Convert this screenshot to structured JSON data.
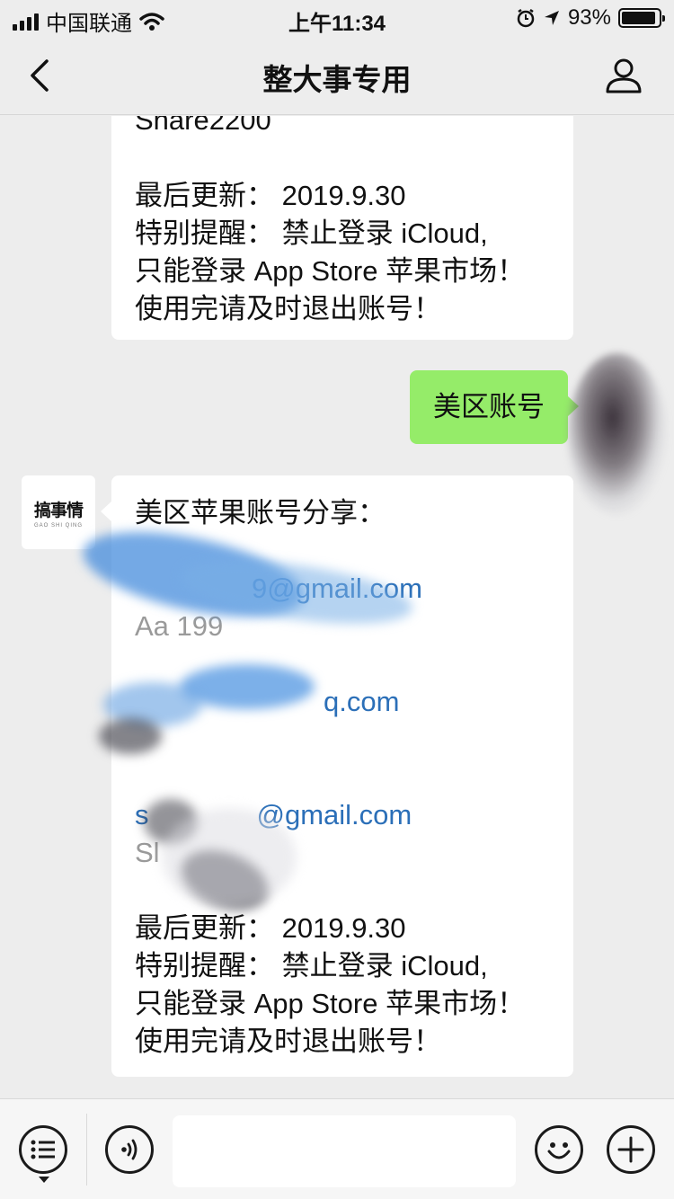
{
  "status_bar": {
    "carrier": "中国联通",
    "time": "上午11:34",
    "battery_percent": "93%",
    "battery_level": 0.93
  },
  "nav": {
    "title": "整大事专用"
  },
  "messages": {
    "first": {
      "partial_top": "Share2200",
      "updated": "最后更新： 2019.9.30",
      "reminder_1": "特别提醒： 禁止登录 iCloud,",
      "reminder_2": "只能登录 App Store 苹果市场！",
      "reminder_3": "使用完请及时退出账号！"
    },
    "sent": {
      "text": "美区账号"
    },
    "second": {
      "heading": "美区苹果账号分享：",
      "email_1_tail": "9@gmail.com",
      "password_1_tail": "Aa      199",
      "email_2_tail": "q.com",
      "email_3_tail": "@gmail.com",
      "email_3_start": "s",
      "password_3_start": "Sl",
      "updated": "最后更新： 2019.9.30",
      "reminder_1": "特别提醒： 禁止登录 iCloud,",
      "reminder_2": "只能登录 App Store 苹果市场！",
      "reminder_3": "使用完请及时退出账号！"
    }
  },
  "avatar_left": {
    "logo_text": "搞事情",
    "logo_sub": "GAO SHI QING"
  },
  "colors": {
    "background": "#ededed",
    "sent_bubble": "#95ec69",
    "received_bubble": "#ffffff",
    "link": "#2b6fb8"
  },
  "icons": {
    "back": "chevron-left-icon",
    "profile": "person-icon",
    "menu": "list-menu-icon",
    "voice": "voice-icon",
    "emoji": "smiley-icon",
    "add": "plus-icon"
  }
}
